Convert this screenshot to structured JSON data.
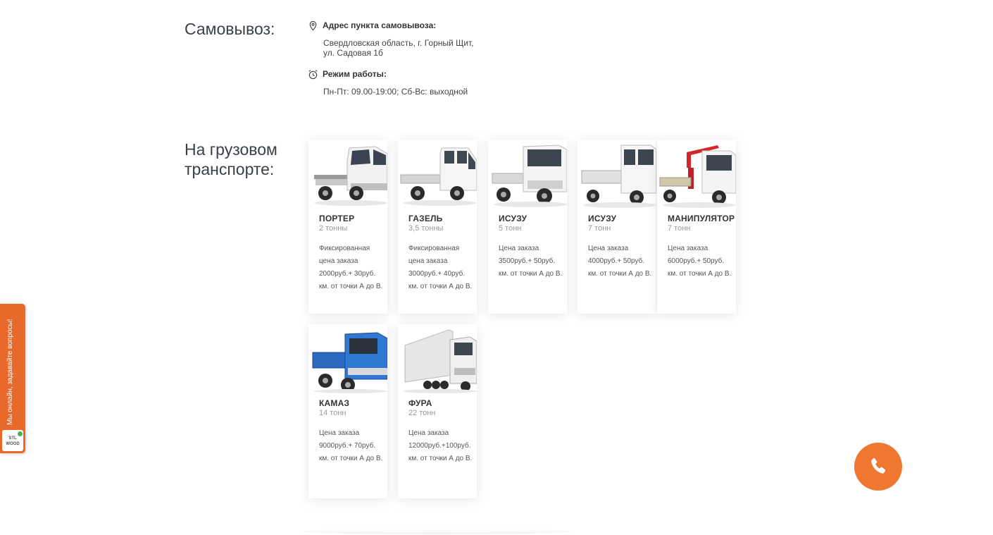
{
  "pickup": {
    "title": "Самовывоз:",
    "address_label": "Адрес пункта самовывоза:",
    "address": "Свердловская область, г. Горный Щит,\nул. Садовая 1б",
    "hours_label": "Режим работы:",
    "hours": "Пн-Пт: 09.00-19:00; Сб-Вс: выходной"
  },
  "truck_section": {
    "title": "На грузовом\nтранспорте:",
    "cards": [
      {
        "name": "ПОРТЕР",
        "capacity": "2 тонны",
        "desc": "Фиксированная цена заказа 2000руб.+ 30руб. км. от точки А до В."
      },
      {
        "name": "ГАЗЕЛЬ",
        "capacity": "3,5 тонны",
        "desc": "Фиксированная цена заказа 3000руб.+ 40руб. км. от точки А до В."
      },
      {
        "name": "ИСУЗУ",
        "capacity": "5 тонн",
        "desc": "Цена заказа 3500руб.+ 50руб. км. от точки А до В."
      },
      {
        "name": "ИСУЗУ",
        "capacity": "7 тонн",
        "desc": "Цена заказа 4000руб.+ 50руб. км. от точки А до В."
      },
      {
        "name": "МАНИПУЛЯТОР",
        "capacity": "7 тонн",
        "desc": "Цена заказа 6000руб.+ 50руб. км. от точки А до В."
      },
      {
        "name": "КАМАЗ",
        "capacity": "14 тонн",
        "desc": "Цена заказа 9000руб.+ 70руб. км. от точки А до В."
      },
      {
        "name": "ФУРА",
        "capacity": "22 тонн",
        "desc": "Цена заказа 12000руб.+100руб. км. от точки А до В."
      }
    ]
  },
  "chat_widget": {
    "text": "Мы онлайн, задавайте вопросы!",
    "logo_line1": "STL",
    "logo_line2": "WOOD"
  },
  "icons": {
    "address": "map-pin-icon",
    "hours": "alarm-clock-icon",
    "call": "phone-icon"
  },
  "colors": {
    "accent": "#ef7730",
    "chat_tab": "#e8692a",
    "online_dot": "#3db84b"
  }
}
